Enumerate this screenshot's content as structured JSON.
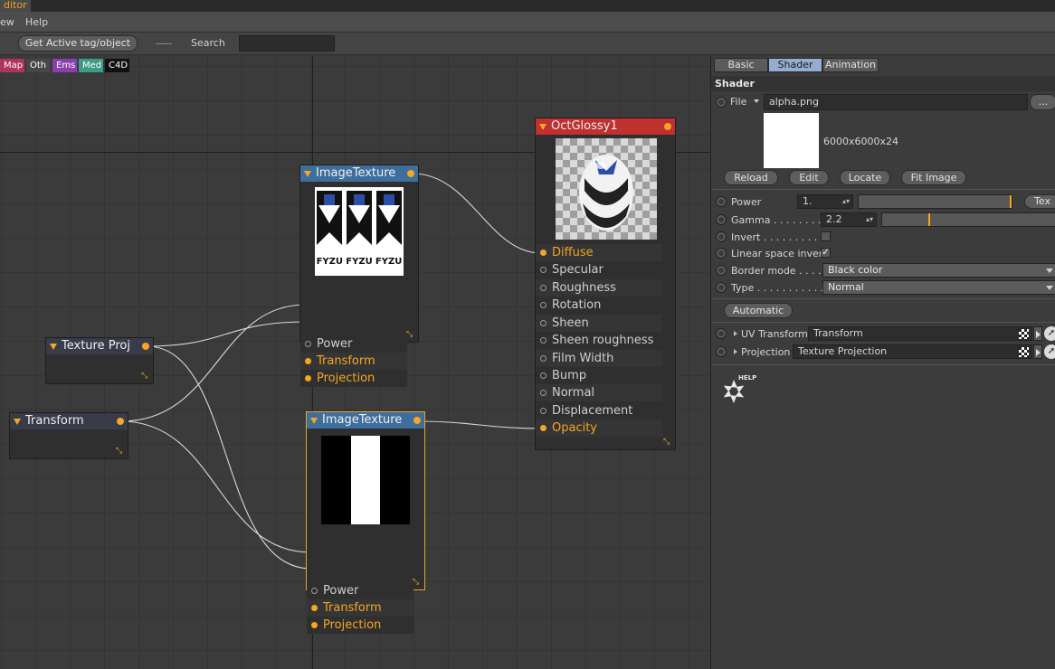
{
  "window": {
    "title_fragment": "ditor",
    "menu": [
      "ew",
      "Help"
    ]
  },
  "toolbar": {
    "get_active_label": "Get Active tag/object",
    "search_label": "Search",
    "search_value": ""
  },
  "filters": [
    {
      "label": "Map",
      "color": "#b0335a"
    },
    {
      "label": "Oth",
      "color": "#474747"
    },
    {
      "label": "Ems",
      "color": "#8a3fb0"
    },
    {
      "label": "Med",
      "color": "#3c9a86"
    },
    {
      "label": "C4D",
      "color": "#111111"
    }
  ],
  "nodes": {
    "texture_proj": {
      "title": "Texture Proj"
    },
    "transform": {
      "title": "Transform"
    },
    "image_texture_1": {
      "title": "ImageTexture",
      "header_color": "#3e6e9c",
      "preview_text": "FYZU",
      "ports": [
        {
          "label": "Power",
          "connected": false
        },
        {
          "label": "Transform",
          "connected": true
        },
        {
          "label": "Projection",
          "connected": true
        }
      ]
    },
    "image_texture_2": {
      "title": "ImageTexture",
      "header_color": "#3e6e9c",
      "ports": [
        {
          "label": "Power",
          "connected": false
        },
        {
          "label": "Transform",
          "connected": true
        },
        {
          "label": "Projection",
          "connected": true
        }
      ]
    },
    "oct_glossy": {
      "title": "OctGlossy1",
      "header_color": "#c0302e",
      "ports": [
        {
          "label": "Diffuse",
          "connected": true
        },
        {
          "label": "Specular",
          "connected": false
        },
        {
          "label": "Roughness",
          "connected": false
        },
        {
          "label": "Rotation",
          "connected": false
        },
        {
          "label": "Sheen",
          "connected": false
        },
        {
          "label": "Sheen roughness",
          "connected": false
        },
        {
          "label": "Film Width",
          "connected": false
        },
        {
          "label": "Bump",
          "connected": false
        },
        {
          "label": "Normal",
          "connected": false
        },
        {
          "label": "Displacement",
          "connected": false
        },
        {
          "label": "Opacity",
          "connected": true
        }
      ]
    }
  },
  "panel": {
    "tabs": [
      "Basic",
      "Shader",
      "Animation"
    ],
    "active_tab": "Shader",
    "section": "Shader",
    "file_label": "File",
    "file_value": "alpha.png",
    "browse_label": "...",
    "resolution": "6000x6000x24",
    "buttons": [
      "Reload",
      "Edit",
      "Locate",
      "Fit Image"
    ],
    "power": {
      "label": "Power",
      "value": "1.",
      "slider_fraction": 1.0,
      "tex_label": "Tex"
    },
    "gamma": {
      "label": "Gamma . . . . . . . . . .",
      "value": "2.2",
      "slider_fraction": 0.28
    },
    "invert": {
      "label": "Invert . . . . . . . . . . .",
      "checked": false
    },
    "linear_space": {
      "label": "Linear space invert",
      "checked": true
    },
    "border_mode": {
      "label": "Border mode . . . . .",
      "value": "Black color"
    },
    "type": {
      "label": "Type . . . . . . . . . . . .",
      "value": "Normal"
    },
    "automatic_label": "Automatic",
    "uv_transform": {
      "label": "UV Transform",
      "value": "Transform"
    },
    "projection": {
      "label": "Projection",
      "value": "Texture Projection"
    },
    "help_label": "HELP"
  }
}
